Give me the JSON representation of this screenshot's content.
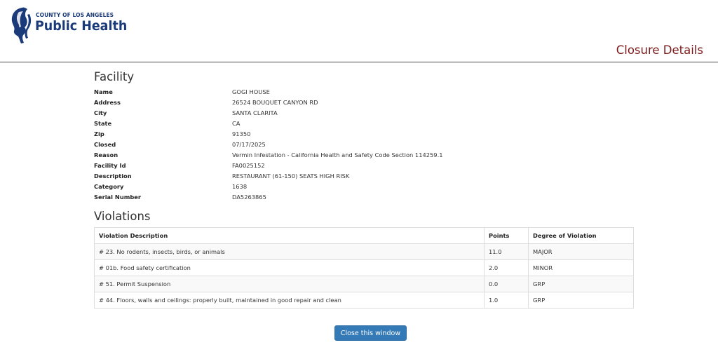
{
  "header": {
    "logo_county": "COUNTY OF LOS ANGELES",
    "logo_main": "Public Health",
    "page_title": "Closure Details"
  },
  "facility": {
    "heading": "Facility",
    "fields": [
      {
        "label": "Name",
        "value": "GOGI HOUSE"
      },
      {
        "label": "Address",
        "value": "26524 BOUQUET CANYON RD"
      },
      {
        "label": "City",
        "value": "SANTA CLARITA"
      },
      {
        "label": "State",
        "value": "CA"
      },
      {
        "label": "Zip",
        "value": "91350"
      },
      {
        "label": "Closed",
        "value": "07/17/2025"
      },
      {
        "label": "Reason",
        "value": "Vermin Infestation - California Health and Safety Code Section 114259.1"
      },
      {
        "label": "Facility Id",
        "value": "FA0025152"
      },
      {
        "label": "Description",
        "value": "RESTAURANT (61-150) SEATS HIGH RISK"
      },
      {
        "label": "Category",
        "value": "1638"
      },
      {
        "label": "Serial Number",
        "value": "DA5263865"
      }
    ]
  },
  "violations": {
    "heading": "Violations",
    "columns": [
      "Violation Description",
      "Points",
      "Degree of Violation"
    ],
    "rows": [
      [
        "# 23. No rodents, insects, birds, or animals",
        "11.0",
        "MAJOR"
      ],
      [
        "# 01b. Food safety certification",
        "2.0",
        "MINOR"
      ],
      [
        "# 51. Permit Suspension",
        "0.0",
        "GRP"
      ],
      [
        "# 44. Floors, walls and ceilings: properly built, maintained in good repair and clean",
        "1.0",
        "GRP"
      ]
    ]
  },
  "footer": {
    "close_label": "Close this window"
  },
  "colors": {
    "brand_blue": "#1b3a7a",
    "title_maroon": "#7b1a1a",
    "button_blue": "#337ab7"
  }
}
